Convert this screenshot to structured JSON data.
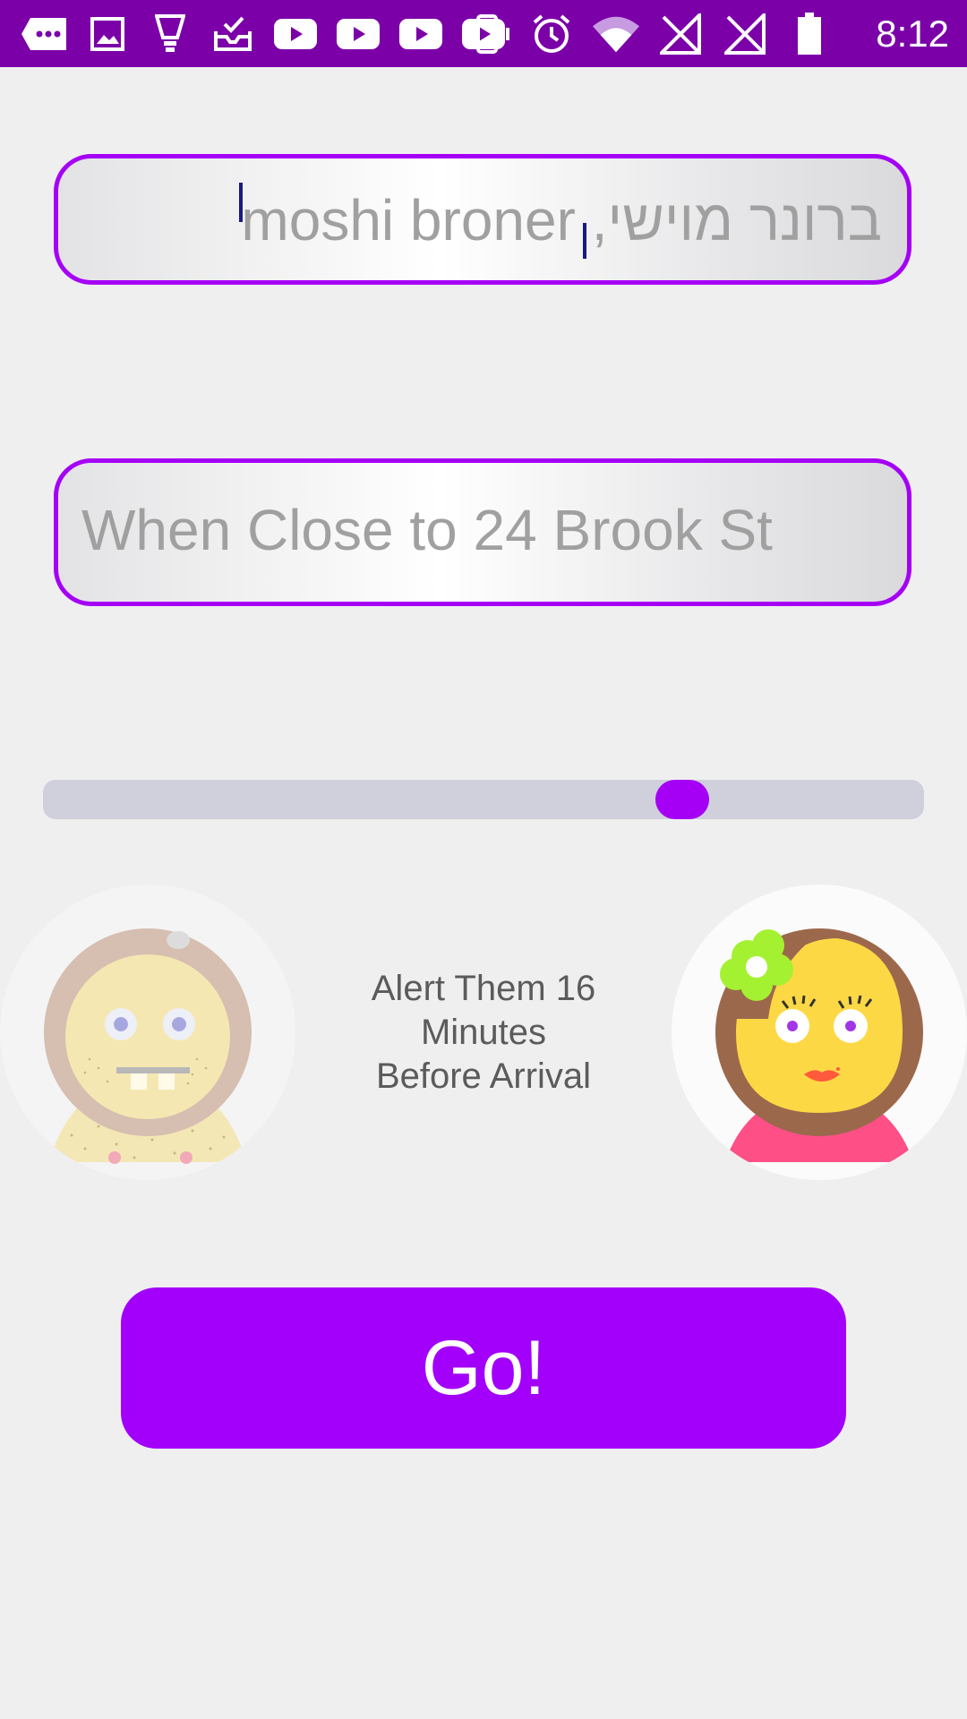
{
  "status_bar": {
    "time": "8:12",
    "background": "#7b00a8",
    "left_icons": [
      "more-icon",
      "gallery-icon",
      "lightbulb-icon",
      "inbox-check-icon",
      "youtube-icon",
      "youtube-icon",
      "youtube-icon",
      "youtube-icon"
    ],
    "right_icons": [
      "vibrate-icon",
      "alarm-icon",
      "wifi-icon",
      "no-signal-icon",
      "no-signal-icon",
      "battery-icon"
    ]
  },
  "contact_field": {
    "value": "moshi broner ,ברונר מוישי",
    "border_color": "#a500f5"
  },
  "location_field": {
    "value": "When Close to 24 Brook St",
    "border_color": "#a500f5"
  },
  "slider": {
    "value_fraction": 0.74,
    "track_color": "#d0d0dc",
    "thumb_color": "#a500f5"
  },
  "alert": {
    "line1": "Alert Them 16",
    "line2": "Minutes",
    "line3": "Before Arrival"
  },
  "avatars": {
    "left": "boy-avatar-icon",
    "right": "girl-avatar-icon"
  },
  "go_button": {
    "label": "Go!",
    "color": "#a200fa"
  }
}
